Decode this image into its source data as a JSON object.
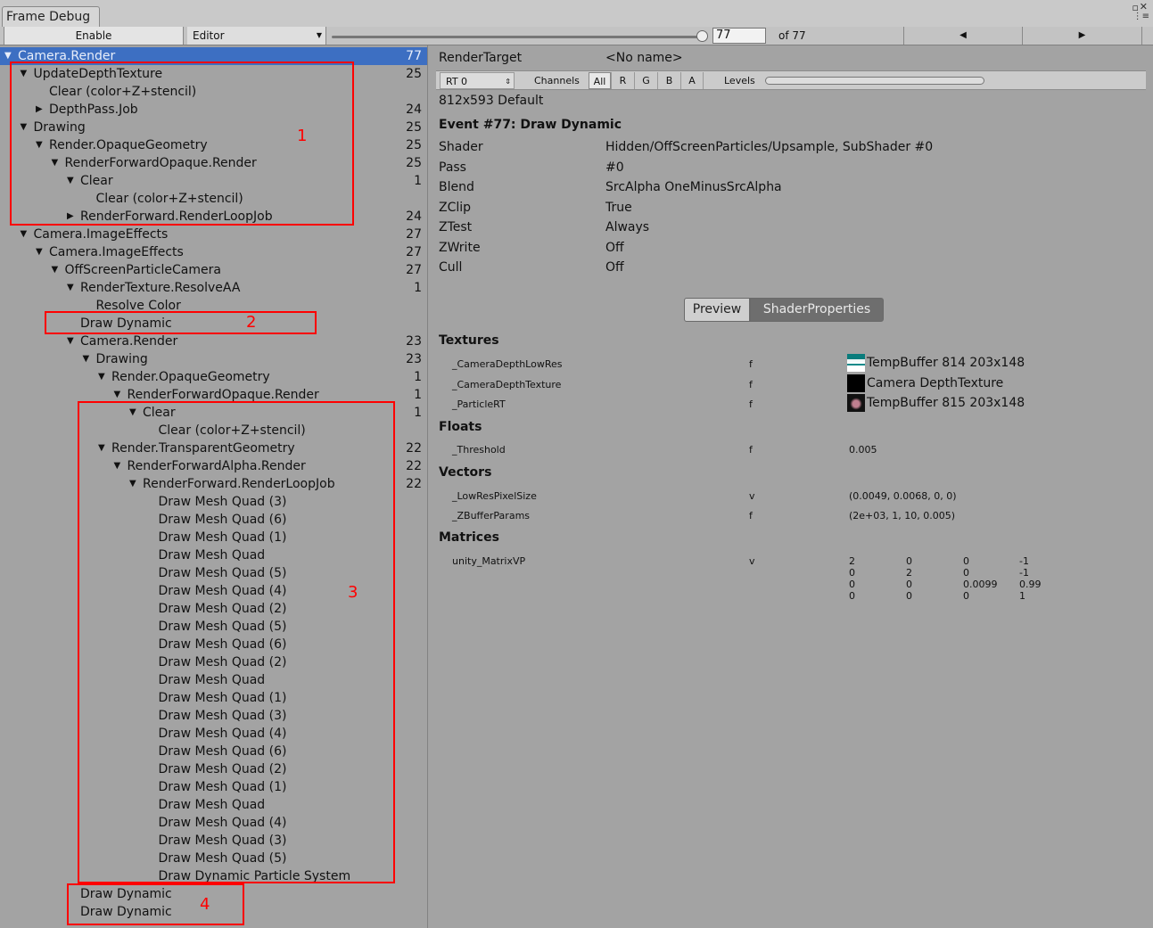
{
  "window": {
    "tab_title": "Frame Debug",
    "controls": "▫ ✕"
  },
  "toolbar": {
    "enable_label": "Enable",
    "target_label": "Editor",
    "frame_value": "77",
    "of_label": "of 77",
    "prev_icon": "◀",
    "next_icon": "▶",
    "slider_fraction": 1.0
  },
  "tree": [
    {
      "label": "Camera.Render",
      "count": "77",
      "depth": 0,
      "arrow": "▼",
      "selected": true
    },
    {
      "label": "UpdateDepthTexture",
      "count": "25",
      "depth": 1,
      "arrow": "▼"
    },
    {
      "label": "Clear (color+Z+stencil)",
      "count": "",
      "depth": 2,
      "arrow": ""
    },
    {
      "label": "DepthPass.Job",
      "count": "24",
      "depth": 2,
      "arrow": "▶"
    },
    {
      "label": "Drawing",
      "count": "25",
      "depth": 1,
      "arrow": "▼"
    },
    {
      "label": "Render.OpaqueGeometry",
      "count": "25",
      "depth": 2,
      "arrow": "▼"
    },
    {
      "label": "RenderForwardOpaque.Render",
      "count": "25",
      "depth": 3,
      "arrow": "▼"
    },
    {
      "label": "Clear",
      "count": "1",
      "depth": 4,
      "arrow": "▼"
    },
    {
      "label": "Clear (color+Z+stencil)",
      "count": "",
      "depth": 5,
      "arrow": ""
    },
    {
      "label": "RenderForward.RenderLoopJob",
      "count": "24",
      "depth": 4,
      "arrow": "▶"
    },
    {
      "label": "Camera.ImageEffects",
      "count": "27",
      "depth": 1,
      "arrow": "▼"
    },
    {
      "label": "Camera.ImageEffects",
      "count": "27",
      "depth": 2,
      "arrow": "▼"
    },
    {
      "label": "OffScreenParticleCamera",
      "count": "27",
      "depth": 3,
      "arrow": "▼"
    },
    {
      "label": "RenderTexture.ResolveAA",
      "count": "1",
      "depth": 4,
      "arrow": "▼"
    },
    {
      "label": "Resolve Color",
      "count": "",
      "depth": 5,
      "arrow": ""
    },
    {
      "label": "Draw Dynamic",
      "count": "",
      "depth": 4,
      "arrow": ""
    },
    {
      "label": "Camera.Render",
      "count": "23",
      "depth": 4,
      "arrow": "▼"
    },
    {
      "label": "Drawing",
      "count": "23",
      "depth": 5,
      "arrow": "▼"
    },
    {
      "label": "Render.OpaqueGeometry",
      "count": "1",
      "depth": 6,
      "arrow": "▼"
    },
    {
      "label": "RenderForwardOpaque.Render",
      "count": "1",
      "depth": 7,
      "arrow": "▼"
    },
    {
      "label": "Clear",
      "count": "1",
      "depth": 8,
      "arrow": "▼"
    },
    {
      "label": "Clear (color+Z+stencil)",
      "count": "",
      "depth": 9,
      "arrow": ""
    },
    {
      "label": "Render.TransparentGeometry",
      "count": "22",
      "depth": 6,
      "arrow": "▼"
    },
    {
      "label": "RenderForwardAlpha.Render",
      "count": "22",
      "depth": 7,
      "arrow": "▼"
    },
    {
      "label": "RenderForward.RenderLoopJob",
      "count": "22",
      "depth": 8,
      "arrow": "▼"
    },
    {
      "label": "Draw Mesh Quad (3)",
      "count": "",
      "depth": 9,
      "arrow": ""
    },
    {
      "label": "Draw Mesh Quad (6)",
      "count": "",
      "depth": 9,
      "arrow": ""
    },
    {
      "label": "Draw Mesh Quad (1)",
      "count": "",
      "depth": 9,
      "arrow": ""
    },
    {
      "label": "Draw Mesh Quad",
      "count": "",
      "depth": 9,
      "arrow": ""
    },
    {
      "label": "Draw Mesh Quad (5)",
      "count": "",
      "depth": 9,
      "arrow": ""
    },
    {
      "label": "Draw Mesh Quad (4)",
      "count": "",
      "depth": 9,
      "arrow": ""
    },
    {
      "label": "Draw Mesh Quad (2)",
      "count": "",
      "depth": 9,
      "arrow": ""
    },
    {
      "label": "Draw Mesh Quad (5)",
      "count": "",
      "depth": 9,
      "arrow": ""
    },
    {
      "label": "Draw Mesh Quad (6)",
      "count": "",
      "depth": 9,
      "arrow": ""
    },
    {
      "label": "Draw Mesh Quad (2)",
      "count": "",
      "depth": 9,
      "arrow": ""
    },
    {
      "label": "Draw Mesh Quad",
      "count": "",
      "depth": 9,
      "arrow": ""
    },
    {
      "label": "Draw Mesh Quad (1)",
      "count": "",
      "depth": 9,
      "arrow": ""
    },
    {
      "label": "Draw Mesh Quad (3)",
      "count": "",
      "depth": 9,
      "arrow": ""
    },
    {
      "label": "Draw Mesh Quad (4)",
      "count": "",
      "depth": 9,
      "arrow": ""
    },
    {
      "label": "Draw Mesh Quad (6)",
      "count": "",
      "depth": 9,
      "arrow": ""
    },
    {
      "label": "Draw Mesh Quad (2)",
      "count": "",
      "depth": 9,
      "arrow": ""
    },
    {
      "label": "Draw Mesh Quad (1)",
      "count": "",
      "depth": 9,
      "arrow": ""
    },
    {
      "label": "Draw Mesh Quad",
      "count": "",
      "depth": 9,
      "arrow": ""
    },
    {
      "label": "Draw Mesh Quad (4)",
      "count": "",
      "depth": 9,
      "arrow": ""
    },
    {
      "label": "Draw Mesh Quad (3)",
      "count": "",
      "depth": 9,
      "arrow": ""
    },
    {
      "label": "Draw Mesh Quad (5)",
      "count": "",
      "depth": 9,
      "arrow": ""
    },
    {
      "label": "Draw Dynamic Particle System",
      "count": "",
      "depth": 9,
      "arrow": ""
    },
    {
      "label": "Draw Dynamic",
      "count": "",
      "depth": 4,
      "arrow": ""
    },
    {
      "label": "Draw Dynamic",
      "count": "",
      "depth": 4,
      "arrow": ""
    }
  ],
  "annotations": {
    "box1": "1",
    "box2": "2",
    "box3": "3",
    "box4": "4"
  },
  "details": {
    "render_target_label": "RenderTarget",
    "render_target_value": "<No name>",
    "rt_select": "RT 0",
    "channels_label": "Channels",
    "channels": [
      "All",
      "R",
      "G",
      "B",
      "A"
    ],
    "levels_label": "Levels",
    "resolution": "812x593 Default",
    "event_title": "Event #77: Draw Dynamic",
    "props": [
      {
        "k": "Shader",
        "v": "Hidden/OffScreenParticles/Upsample, SubShader #0"
      },
      {
        "k": "Pass",
        "v": "#0"
      },
      {
        "k": "Blend",
        "v": "SrcAlpha OneMinusSrcAlpha"
      },
      {
        "k": "ZClip",
        "v": "True"
      },
      {
        "k": "ZTest",
        "v": "Always"
      },
      {
        "k": "ZWrite",
        "v": "Off"
      },
      {
        "k": "Cull",
        "v": "Off"
      }
    ],
    "tab_preview": "Preview",
    "tab_shader_props": "ShaderProperties",
    "textures_header": "Textures",
    "textures": [
      {
        "name": "_CameraDepthLowRes",
        "stage": "f",
        "value": "TempBuffer 814 203x148"
      },
      {
        "name": "_CameraDepthTexture",
        "stage": "f",
        "value": "Camera DepthTexture"
      },
      {
        "name": "_ParticleRT",
        "stage": "f",
        "value": "TempBuffer 815 203x148"
      }
    ],
    "floats_header": "Floats",
    "floats": [
      {
        "name": "_Threshold",
        "stage": "f",
        "value": "0.005"
      }
    ],
    "vectors_header": "Vectors",
    "vectors": [
      {
        "name": "_LowResPixelSize",
        "stage": "v",
        "value": "(0.0049, 0.0068, 0, 0)"
      },
      {
        "name": "_ZBufferParams",
        "stage": "f",
        "value": "(2e+03, 1, 10, 0.005)"
      }
    ],
    "matrices_header": "Matrices",
    "matrix_name": "unity_MatrixVP",
    "matrix_stage": "v",
    "matrix": [
      [
        "2",
        "0",
        "0",
        "-1"
      ],
      [
        "0",
        "2",
        "0",
        "-1"
      ],
      [
        "0",
        "0",
        "0.0099",
        "0.99"
      ],
      [
        "0",
        "0",
        "0",
        "1"
      ]
    ]
  }
}
